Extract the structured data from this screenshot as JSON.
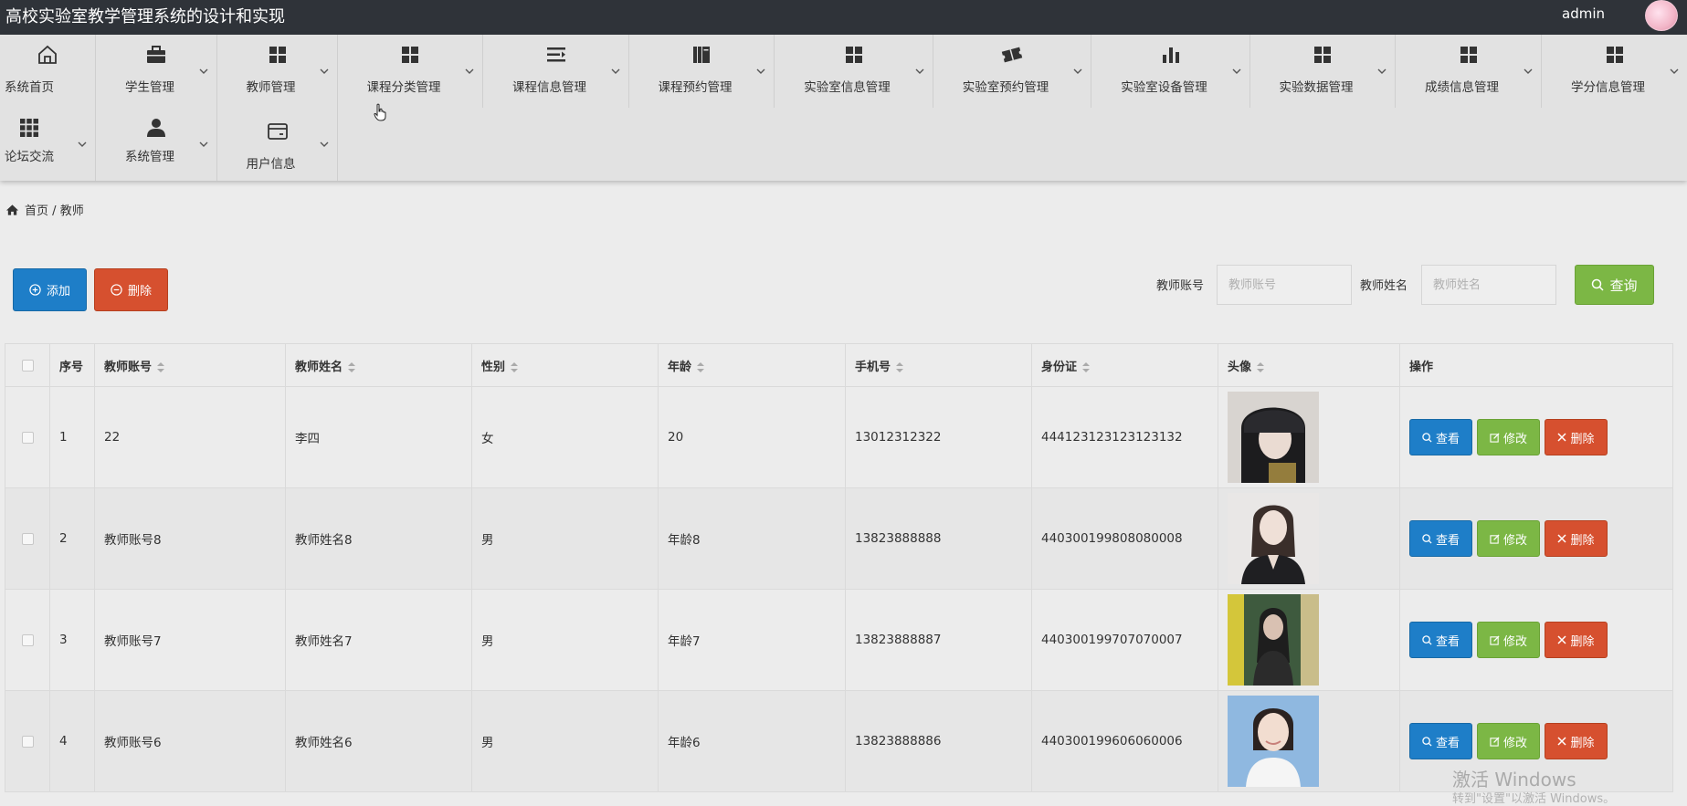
{
  "app": {
    "title": "高校实验室教学管理系统的设计和实现",
    "user": "admin"
  },
  "nav": {
    "items": [
      {
        "label": "系统首页",
        "icon": "home-icon"
      },
      {
        "label": "学生管理",
        "icon": "briefcase-icon"
      },
      {
        "label": "教师管理",
        "icon": "grid-icon"
      },
      {
        "label": "课程分类管理",
        "icon": "grid-icon"
      },
      {
        "label": "课程信息管理",
        "icon": "list-icon"
      },
      {
        "label": "课程预约管理",
        "icon": "books-icon"
      },
      {
        "label": "实验室信息管理",
        "icon": "grid-icon"
      },
      {
        "label": "实验室预约管理",
        "icon": "ticket-icon"
      },
      {
        "label": "实验室设备管理",
        "icon": "bar-chart-icon"
      },
      {
        "label": "实验数据管理",
        "icon": "grid-icon"
      },
      {
        "label": "成绩信息管理",
        "icon": "grid-icon"
      },
      {
        "label": "学分信息管理",
        "icon": "grid-icon"
      },
      {
        "label": "论坛交流",
        "icon": "apps-icon"
      },
      {
        "label": "系统管理",
        "icon": "person-icon"
      },
      {
        "label": "用户信息",
        "icon": "card-icon"
      }
    ]
  },
  "breadcrumb": {
    "home": "首页",
    "separator": "/",
    "current": "教师"
  },
  "toolbar": {
    "add_label": "添加",
    "delete_label": "删除",
    "account_label": "教师账号",
    "account_placeholder": "教师账号",
    "name_label": "教师姓名",
    "name_placeholder": "教师姓名",
    "search_label": "查询"
  },
  "table": {
    "headers": [
      "序号",
      "教师账号",
      "教师姓名",
      "性别",
      "年龄",
      "手机号",
      "身份证",
      "头像",
      "操作"
    ],
    "rows": [
      {
        "no": "1",
        "account": "22",
        "name": "李四",
        "gender": "女",
        "age": "20",
        "phone": "13012312322",
        "id_card": "444123123123123132"
      },
      {
        "no": "2",
        "account": "教师账号8",
        "name": "教师姓名8",
        "gender": "男",
        "age": "年龄8",
        "phone": "13823888888",
        "id_card": "440300199808080008"
      },
      {
        "no": "3",
        "account": "教师账号7",
        "name": "教师姓名7",
        "gender": "男",
        "age": "年龄7",
        "phone": "13823888887",
        "id_card": "440300199707070007"
      },
      {
        "no": "4",
        "account": "教师账号6",
        "name": "教师姓名6",
        "gender": "男",
        "age": "年龄6",
        "phone": "13823888886",
        "id_card": "440300199606060006"
      }
    ],
    "actions": {
      "view": "查看",
      "edit": "修改",
      "delete": "删除"
    }
  },
  "watermark": {
    "line1": "激活 Windows",
    "line2": "转到\"设置\"以激活 Windows。"
  },
  "colors": {
    "topbar": "#2f3339",
    "nav_bg": "#e2e2e2",
    "primary": "#1e7ec8",
    "success": "#7cb745",
    "danger": "#d6502f"
  }
}
